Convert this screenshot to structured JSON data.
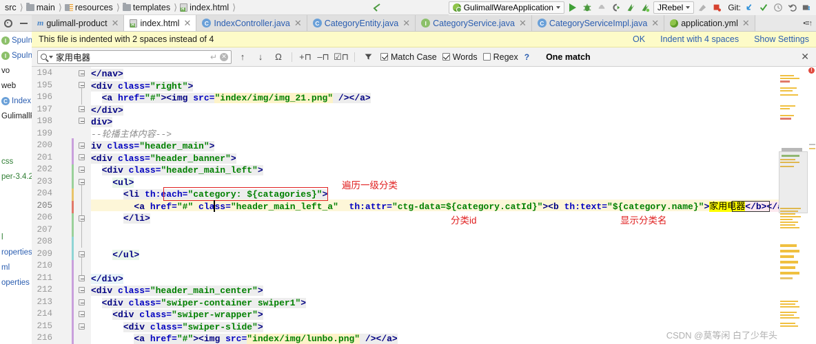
{
  "breadcrumb": {
    "items": [
      {
        "label": "src",
        "icon": "none"
      },
      {
        "label": "main",
        "icon": "folder-icon"
      },
      {
        "label": "resources",
        "icon": "resources-folder-icon"
      },
      {
        "label": "templates",
        "icon": "folder-icon"
      },
      {
        "label": "index.html",
        "icon": "html-file-icon"
      }
    ]
  },
  "toolbar": {
    "run_configuration": "GulimallWareApplication",
    "jrebel_label": "JRebel",
    "git_label": "Git:",
    "icons": [
      "run-icon",
      "debug-icon",
      "coverage-icon",
      "profile-icon",
      "jrebel-run-icon",
      "jrebel-debug-icon",
      "stop-icon",
      "build-icon",
      "git-update-icon",
      "git-commit-icon",
      "git-history-icon",
      "git-rollback-icon",
      "git-branch-icon"
    ]
  },
  "tabs": [
    {
      "label": "gulimall-product",
      "icon": "maven-module-icon",
      "active": false
    },
    {
      "label": "index.html",
      "icon": "html-file-icon",
      "active": true
    },
    {
      "label": "IndexController.java",
      "icon": "class-icon",
      "active": false
    },
    {
      "label": "CategoryEntity.java",
      "icon": "class-icon",
      "active": false
    },
    {
      "label": "CategoryService.java",
      "icon": "interface-icon",
      "active": false
    },
    {
      "label": "CategoryServiceImpl.java",
      "icon": "class-icon",
      "active": false
    },
    {
      "label": "application.yml",
      "icon": "spring-yaml-icon",
      "active": false
    }
  ],
  "notification": {
    "message": "This file is indented with 2 spaces instead of 4",
    "actions": [
      "OK",
      "Indent with 4 spaces",
      "Show Settings"
    ]
  },
  "find": {
    "query": "家用电器",
    "placeholder": "",
    "match_case_label": "Match Case",
    "match_case_checked": true,
    "words_label": "Words",
    "words_checked": true,
    "regex_label": "Regex",
    "regex_checked": false,
    "help_label": "?",
    "result_text": "One match",
    "buttons": [
      "search-dropdown-icon",
      "enter-icon",
      "clear-icon",
      "find-previous-icon",
      "find-next-icon",
      "select-all-occurrences-icon",
      "add-selection-icon",
      "remove-selection-icon",
      "select-all-icon",
      "filter-icon",
      "close-icon"
    ]
  },
  "sidebar": {
    "items": [
      {
        "label": "SpuIn",
        "icon": "interface-icon",
        "style": "blue"
      },
      {
        "label": "SpuIn",
        "icon": "interface-icon",
        "style": "blue"
      },
      {
        "label": "vo",
        "icon": "none",
        "style": "plain"
      },
      {
        "label": "web",
        "icon": "none",
        "style": "plain"
      },
      {
        "label": "Index",
        "icon": "class-icon",
        "style": "blue"
      },
      {
        "label": "GulimallP",
        "icon": "none",
        "style": "plain"
      },
      {
        "label": "",
        "icon": "none",
        "style": "plain"
      },
      {
        "label": "",
        "icon": "none",
        "style": "plain"
      },
      {
        "label": "css",
        "icon": "none",
        "style": "green"
      },
      {
        "label": "per-3.4.2.",
        "icon": "none",
        "style": "green"
      },
      {
        "label": "",
        "icon": "none",
        "style": "plain"
      },
      {
        "label": "",
        "icon": "none",
        "style": "plain"
      },
      {
        "label": "l",
        "icon": "none",
        "style": "green"
      },
      {
        "label": "roperties",
        "icon": "none",
        "style": "blue"
      },
      {
        "label": "ml",
        "icon": "none",
        "style": "blue"
      },
      {
        "label": "operties",
        "icon": "none",
        "style": "blue"
      }
    ]
  },
  "editor": {
    "first_line": 194,
    "highlighted_line": 205,
    "caret_line": 205,
    "lines": [
      {
        "n": 194,
        "text": "  </nav>"
      },
      {
        "n": 195,
        "text": "  <div class=\"right\">"
      },
      {
        "n": 196,
        "text": "    <a href=\"#\"><img src=\"index/img/img_21.png\" /></a>"
      },
      {
        "n": 197,
        "text": "  </div>"
      },
      {
        "n": 198,
        "text": "div>"
      },
      {
        "n": 199,
        "text": "--轮播主体内容-->"
      },
      {
        "n": 200,
        "text": "iv class=\"header_main\">"
      },
      {
        "n": 201,
        "text": "  <div class=\"header_banner\">"
      },
      {
        "n": 202,
        "text": "    <div class=\"header_main_left\">"
      },
      {
        "n": 203,
        "text": "      <ul>"
      },
      {
        "n": 204,
        "text": "        <li th:each=\"category: ${catagories}\">"
      },
      {
        "n": 205,
        "text": "          <a href=\"#\" class=\"header_main_left_a\"  th:attr=\"ctg-data=${category.catId}\"><b th:text=\"${category.name}\">家用电器</b></a>"
      },
      {
        "n": 206,
        "text": "        </li>"
      },
      {
        "n": 207,
        "text": ""
      },
      {
        "n": 208,
        "text": ""
      },
      {
        "n": 209,
        "text": "      </ul>"
      },
      {
        "n": 210,
        "text": ""
      },
      {
        "n": 211,
        "text": "  </div>"
      },
      {
        "n": 212,
        "text": "  <div class=\"header_main_center\">"
      },
      {
        "n": 213,
        "text": "    <div class=\"swiper-container swiper1\">"
      },
      {
        "n": 214,
        "text": "      <div class=\"swiper-wrapper\">"
      },
      {
        "n": 215,
        "text": "        <div class=\"swiper-slide\">"
      },
      {
        "n": 216,
        "text": "          <a href=\"#\"><img src=\"index/img/lunbo.png\" /></a>"
      }
    ],
    "annotations": [
      {
        "text": "遍历一级分类",
        "color": "#e02020"
      },
      {
        "text": "分类id",
        "color": "#e02020"
      },
      {
        "text": "显示分类名",
        "color": "#e02020"
      }
    ],
    "search_match": "家用电器"
  },
  "watermark": "CSDN @莫等闲 白了少年头",
  "colors": {
    "tag": "#000082",
    "attribute": "#0000c0",
    "string": "#008000",
    "comment": "#8c8c8c",
    "thymeleaf": "#6a0dad",
    "annotation_red": "#e02020",
    "match_highlight": "#ffff00",
    "notification_bg": "#fdfbc8",
    "caret_line_bg": "#fdf6d8",
    "link_blue": "#2a5db0"
  }
}
